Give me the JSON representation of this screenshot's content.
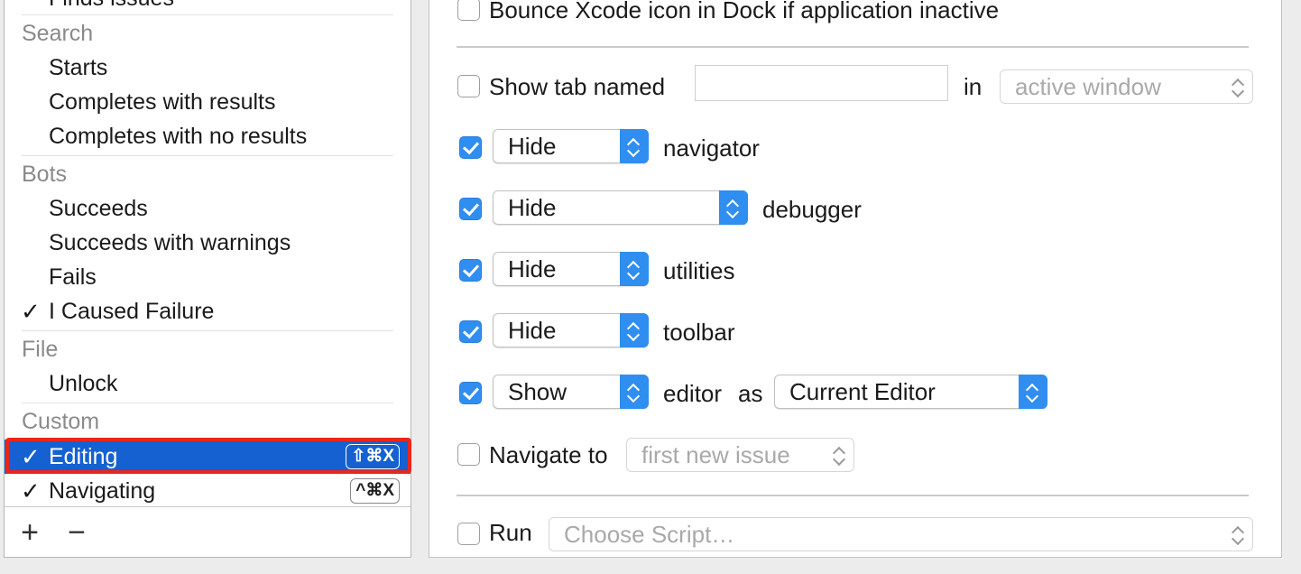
{
  "left_list": {
    "rows": [
      {
        "type": "item",
        "label": "Finds issues"
      },
      {
        "type": "header",
        "label": "Search"
      },
      {
        "type": "item",
        "label": "Starts"
      },
      {
        "type": "item",
        "label": "Completes with results"
      },
      {
        "type": "item",
        "label": "Completes with no results"
      },
      {
        "type": "header",
        "label": "Bots"
      },
      {
        "type": "item",
        "label": "Succeeds"
      },
      {
        "type": "item",
        "label": "Succeeds with warnings"
      },
      {
        "type": "item",
        "label": "Fails"
      },
      {
        "type": "item",
        "label": "I Caused Failure",
        "check": "✓"
      },
      {
        "type": "header",
        "label": "File"
      },
      {
        "type": "item",
        "label": "Unlock"
      },
      {
        "type": "header",
        "label": "Custom"
      },
      {
        "type": "item",
        "label": "Editing",
        "check": "✓",
        "shortcut": "⇧⌘X",
        "selected": true
      },
      {
        "type": "item",
        "label": "Navigating",
        "check": "✓",
        "shortcut": "^⌘X"
      }
    ],
    "add_button": "+",
    "remove_button": "−"
  },
  "options": {
    "bounce": {
      "label": "Bounce Xcode icon in Dock if application inactive",
      "checked": false
    },
    "show_tab": {
      "label": "Show tab named",
      "value": "",
      "in_label": "in",
      "target": "active window",
      "checked": false
    },
    "navigator": {
      "action": "Hide",
      "label": "navigator",
      "checked": true
    },
    "debugger": {
      "action": "Hide",
      "label": "debugger",
      "checked": true
    },
    "utilities": {
      "action": "Hide",
      "label": "utilities",
      "checked": true
    },
    "toolbar": {
      "action": "Hide",
      "label": "toolbar",
      "checked": true
    },
    "editor": {
      "action": "Show",
      "label": "editor",
      "as_label": "as",
      "mode": "Current Editor",
      "checked": true
    },
    "navigate": {
      "label": "Navigate to",
      "target": "first new issue",
      "checked": false
    },
    "run": {
      "label": "Run",
      "script": "Choose Script…",
      "checked": false
    }
  },
  "colors": {
    "selection": "#1561d1",
    "accent": "#2f8ef0",
    "highlight": "#e8261c"
  }
}
